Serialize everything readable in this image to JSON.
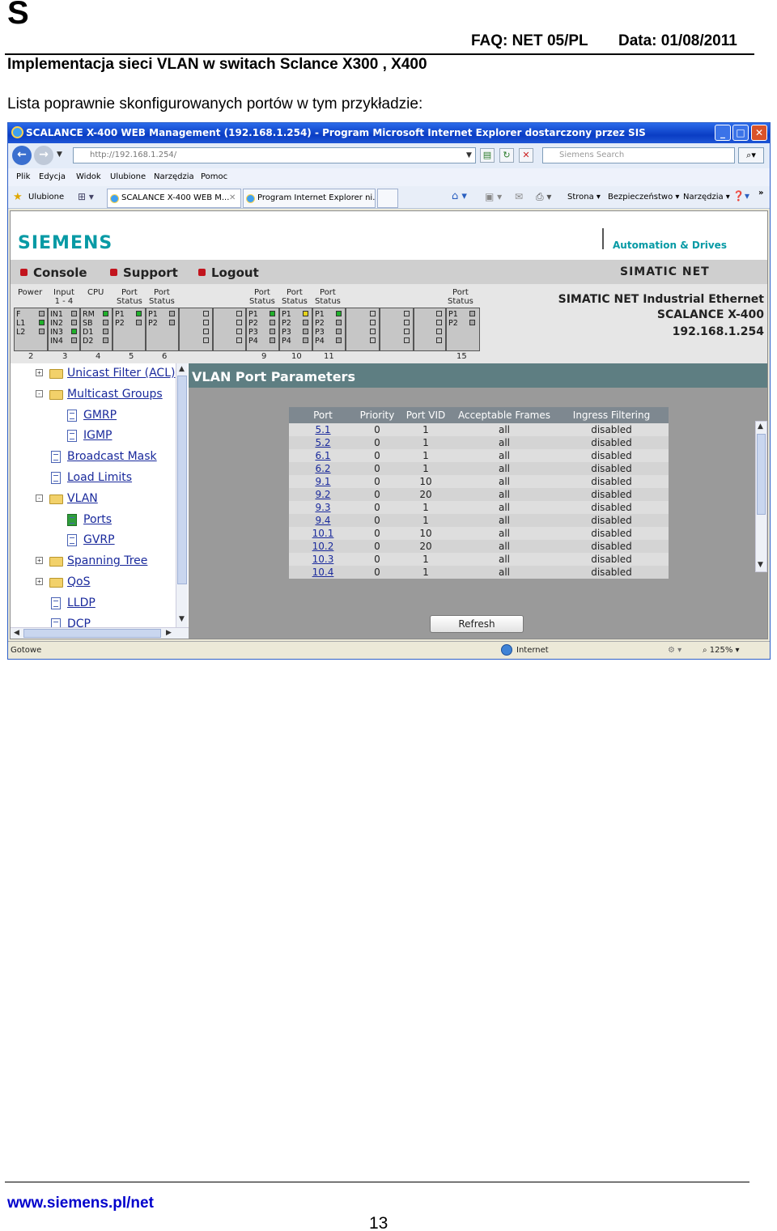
{
  "doc": {
    "logo_letter": "S",
    "faq": "FAQ: NET 05/PL",
    "date": "Data: 01/08/2011",
    "title": "Implementacja sieci VLAN w switach Sclance X300 , X400",
    "intro": "Lista poprawnie skonfigurowanych portów w tym przykładzie:",
    "footer_url": "www.siemens.pl/net",
    "page_number": "13"
  },
  "browser": {
    "window_title": "SCALANCE X-400 WEB Management (192.168.1.254) - Program Microsoft Internet Explorer dostarczony przez SIS",
    "url": "http://192.168.1.254/",
    "search_placeholder": "Siemens Search",
    "menu": [
      "Plik",
      "Edycja",
      "Widok",
      "Ulubione",
      "Narzędzia",
      "Pomoc"
    ],
    "favorites_label": "Ulubione",
    "tabs": [
      "SCALANCE X-400 WEB M...",
      "Program Internet Explorer ni..."
    ],
    "command_items": [
      "Strona",
      "Bezpieczeństwo",
      "Narzędzia"
    ],
    "status_left": "Gotowe",
    "status_zone": "Internet",
    "zoom": "125%",
    "icons": [
      "ie-icon",
      "back-icon",
      "forward-icon",
      "refresh-icon",
      "stop-icon",
      "search-icon",
      "star-icon",
      "home-icon",
      "feed-icon",
      "print-icon",
      "help-icon",
      "globe-icon"
    ]
  },
  "app": {
    "brand": "SIEMENS",
    "tagline": "Automation & Drives",
    "nav": [
      "Console",
      "Support",
      "Logout"
    ],
    "simatic_net": "SIMATIC NET",
    "product": {
      "line1": "SIMATIC NET Industrial Ethernet",
      "line2": "SCALANCE X-400",
      "ip": "192.168.1.254"
    },
    "led_panel": {
      "headers": {
        "power": "Power",
        "input": "Input\n1 - 4",
        "cpu": "CPU",
        "port_status": "Port\nStatus"
      },
      "power_labels": [
        "F",
        "L1",
        "L2"
      ],
      "input_labels": [
        "IN1",
        "IN2",
        "IN3",
        "IN4"
      ],
      "cpu_labels": [
        "RM",
        "SB",
        "D1",
        "D2"
      ],
      "p12": [
        "P1",
        "P2"
      ],
      "p1234": [
        "P1",
        "P2",
        "P3",
        "P4"
      ],
      "slot_numbers": [
        "2",
        "3",
        "4",
        "5",
        "6",
        "9",
        "10",
        "11",
        "15"
      ]
    },
    "tree": [
      {
        "label": "Unicast Filter (ACL)",
        "type": "folder",
        "level": 0,
        "toggle": "+"
      },
      {
        "label": "Multicast Groups",
        "type": "folder-open",
        "level": 0,
        "toggle": "-"
      },
      {
        "label": "GMRP",
        "type": "doc",
        "level": 1
      },
      {
        "label": "IGMP",
        "type": "doc",
        "level": 1
      },
      {
        "label": "Broadcast Mask",
        "type": "doc",
        "level": 0
      },
      {
        "label": "Load Limits",
        "type": "doc",
        "level": 0
      },
      {
        "label": "VLAN",
        "type": "folder-open",
        "level": 0,
        "toggle": "-"
      },
      {
        "label": "Ports",
        "type": "doc-ports",
        "level": 1
      },
      {
        "label": "GVRP",
        "type": "doc",
        "level": 1
      },
      {
        "label": "Spanning Tree",
        "type": "folder",
        "level": 0,
        "toggle": "+"
      },
      {
        "label": "QoS",
        "type": "folder",
        "level": 0,
        "toggle": "+"
      },
      {
        "label": "LLDP",
        "type": "doc",
        "level": 0
      },
      {
        "label": "DCP",
        "type": "doc",
        "level": 0
      }
    ],
    "panel_title": "VLAN Port Parameters",
    "table": {
      "headers": [
        "Port",
        "Priority",
        "Port VID",
        "Acceptable Frames",
        "Ingress Filtering"
      ],
      "rows": [
        [
          "5.1",
          "0",
          "1",
          "all",
          "disabled"
        ],
        [
          "5.2",
          "0",
          "1",
          "all",
          "disabled"
        ],
        [
          "6.1",
          "0",
          "1",
          "all",
          "disabled"
        ],
        [
          "6.2",
          "0",
          "1",
          "all",
          "disabled"
        ],
        [
          "9.1",
          "0",
          "10",
          "all",
          "disabled"
        ],
        [
          "9.2",
          "0",
          "20",
          "all",
          "disabled"
        ],
        [
          "9.3",
          "0",
          "1",
          "all",
          "disabled"
        ],
        [
          "9.4",
          "0",
          "1",
          "all",
          "disabled"
        ],
        [
          "10.1",
          "0",
          "10",
          "all",
          "disabled"
        ],
        [
          "10.2",
          "0",
          "20",
          "all",
          "disabled"
        ],
        [
          "10.3",
          "0",
          "1",
          "all",
          "disabled"
        ],
        [
          "10.4",
          "0",
          "1",
          "all",
          "disabled"
        ]
      ]
    },
    "refresh_label": "Refresh"
  }
}
